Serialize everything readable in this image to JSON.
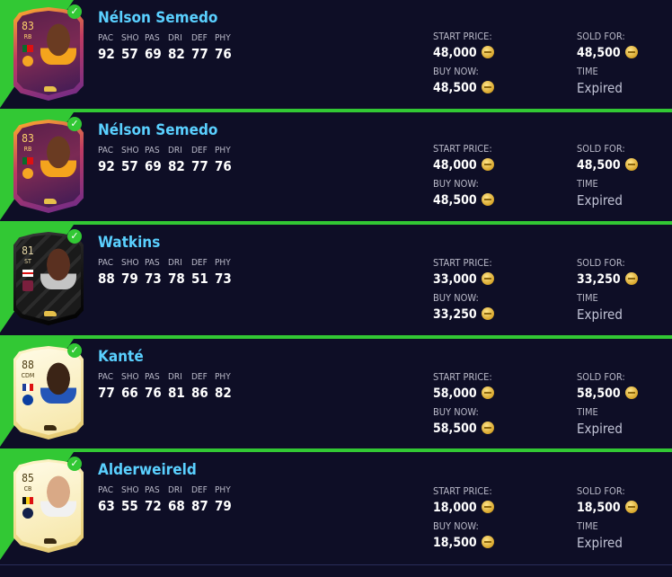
{
  "colors": {
    "background": "#0e0e26",
    "accent_green": "#32c834",
    "player_name": "#5ad0ff",
    "label_grey": "#b9b9c8"
  },
  "attribute_labels": [
    "PAC",
    "SHO",
    "PAS",
    "DRI",
    "DEF",
    "PHY"
  ],
  "price_labels": {
    "start_price": "START PRICE:",
    "buy_now": "BUY NOW:",
    "sold_for": "SOLD FOR:",
    "time": "TIME"
  },
  "coin_icon": "fut-coin-icon",
  "check_icon": "check-icon",
  "items": [
    {
      "name": "Nélson Semedo",
      "rating": "83",
      "position": "RB",
      "card_type": "otw",
      "stats": [
        "92",
        "57",
        "69",
        "82",
        "77",
        "76"
      ],
      "start_price": "48,000",
      "buy_now": "48,500",
      "sold_for": "48,500",
      "time": "Expired"
    },
    {
      "name": "Nélson Semedo",
      "rating": "83",
      "position": "RB",
      "card_type": "otw",
      "stats": [
        "92",
        "57",
        "69",
        "82",
        "77",
        "76"
      ],
      "start_price": "48,000",
      "buy_now": "48,500",
      "sold_for": "48,500",
      "time": "Expired"
    },
    {
      "name": "Watkins",
      "rating": "81",
      "position": "ST",
      "card_type": "totw",
      "stats": [
        "88",
        "79",
        "73",
        "78",
        "51",
        "73"
      ],
      "start_price": "33,000",
      "buy_now": "33,250",
      "sold_for": "33,250",
      "time": "Expired"
    },
    {
      "name": "Kanté",
      "rating": "88",
      "position": "CDM",
      "card_type": "gold",
      "stats": [
        "77",
        "66",
        "76",
        "81",
        "86",
        "82"
      ],
      "start_price": "58,000",
      "buy_now": "58,500",
      "sold_for": "58,500",
      "time": "Expired"
    },
    {
      "name": "Alderweireld",
      "rating": "85",
      "position": "CB",
      "card_type": "gold",
      "stats": [
        "63",
        "55",
        "72",
        "68",
        "87",
        "79"
      ],
      "start_price": "18,000",
      "buy_now": "18,500",
      "sold_for": "18,500",
      "time": "Expired"
    }
  ]
}
